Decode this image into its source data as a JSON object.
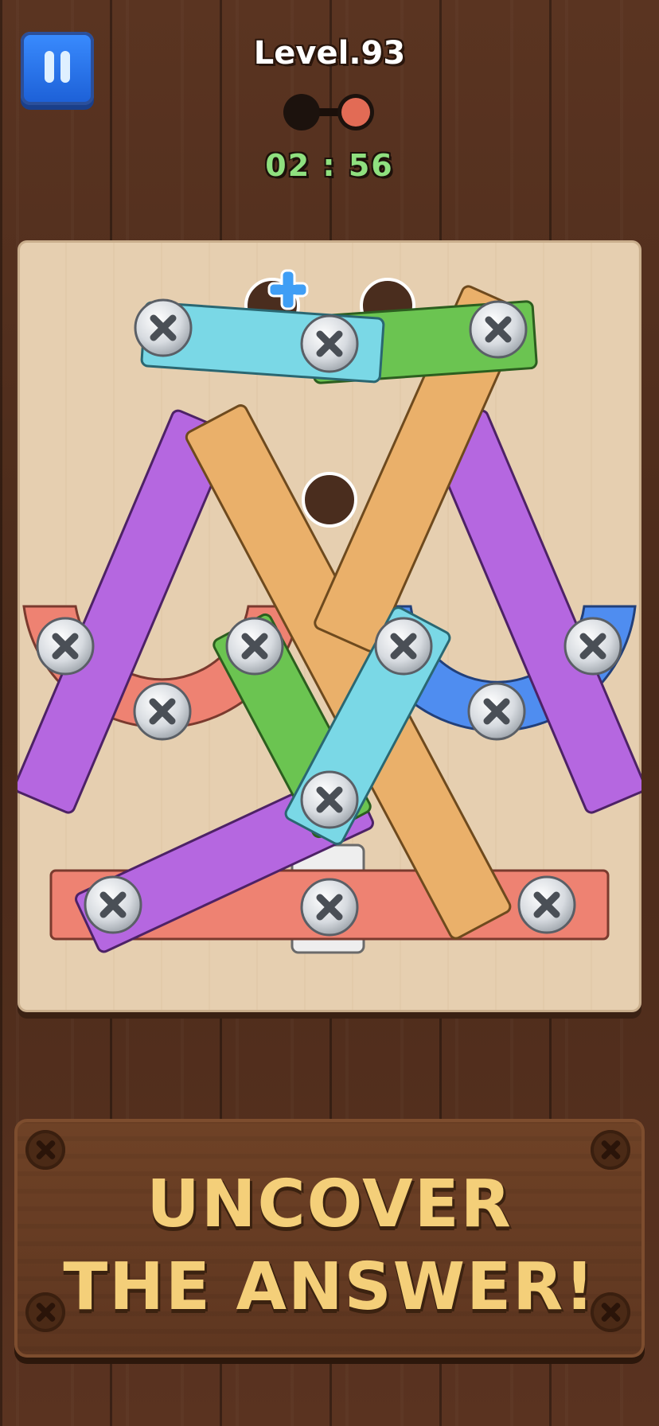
{
  "hud": {
    "level_label": "Level.93",
    "timer": "02 : 56",
    "progress": {
      "completed": 1,
      "total": 2
    }
  },
  "board": {
    "holes": [
      "empty-hole",
      "empty-hole",
      "empty-hole"
    ],
    "add_hole_icon": "plus-icon"
  },
  "banner": {
    "line1": "UNCOVER",
    "line2": "THE ANSWER!"
  },
  "colors": {
    "purple": "#b567e0",
    "orange": "#eab06a",
    "cyan": "#7ad8e6",
    "green": "#6bc451",
    "red": "#ee8272",
    "blue": "#4f8df0",
    "banner_text": "#f4cf79",
    "timer_text": "#8fe07f"
  }
}
